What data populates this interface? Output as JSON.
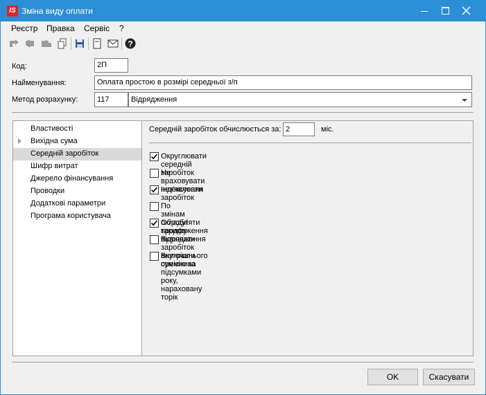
{
  "window": {
    "title": "Зміна виду оплати",
    "app_logo": "IS",
    "accent_color": "#2b8fd6"
  },
  "menu": {
    "items": [
      "Реєстр",
      "Правка",
      "Сервіс",
      "?"
    ]
  },
  "toolbar": {
    "icons": [
      "add-icon",
      "edit-icon",
      "delete-icon",
      "copy-icon",
      "save-icon",
      "document-icon",
      "mail-icon",
      "help-icon"
    ]
  },
  "form": {
    "code_label": "Код:",
    "code_value": "2П",
    "name_label": "Найменування:",
    "name_value": "Оплата простою в розмірі середньої з/п",
    "method_label": "Метод розрахунку:",
    "method_code": "117",
    "method_value": "Відрядження"
  },
  "nav": {
    "items": [
      {
        "label": "Властивості"
      },
      {
        "label": "Вихідна сума"
      },
      {
        "label": "Середній заробіток"
      },
      {
        "label": "Шифр витрат"
      },
      {
        "label": "Джерело фінансування"
      },
      {
        "label": "Проводки"
      },
      {
        "label": "Додаткові параметри"
      },
      {
        "label": "Програма користувача"
      }
    ],
    "selected": "Середній заробіток"
  },
  "content": {
    "months_label": "Середній заробіток обчислюється за:",
    "months_value": "2",
    "months_unit": "міс.",
    "options": [
      {
        "label": "Округлювати середній заробіток",
        "checked": true
      },
      {
        "label": "Не враховувати нез'явлення",
        "checked": false
      },
      {
        "label": "Індексувати заробіток",
        "checked": true
      },
      {
        "label": "По змінам окладу/тарифу",
        "checked": false
      },
      {
        "label": "Обробляти продовження відрядження",
        "checked": true
      },
      {
        "label": "Включати заробіток внутрішнього сумісника",
        "checked": false
      },
      {
        "label": "Включати премію за підсумками року, нараховану торік",
        "checked": false
      }
    ]
  },
  "buttons": {
    "ok": "OK",
    "cancel": "Скасувати"
  }
}
